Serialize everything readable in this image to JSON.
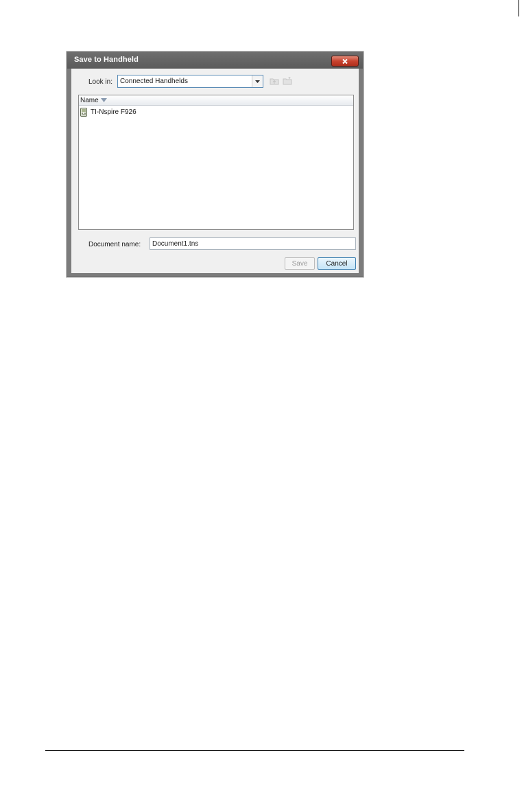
{
  "dialog": {
    "title": "Save to Handheld",
    "close_icon": "close-icon",
    "look_in": {
      "label": "Look in:",
      "value": "Connected Handhelds",
      "dropdown_icon": "chevron-down-icon"
    },
    "toolbar_icons": [
      "folder-up-icon",
      "new-folder-icon"
    ],
    "file_list": {
      "column_header": "Name",
      "sort_icon": "sort-descending-icon",
      "items": [
        {
          "label": "TI-Nspire F926",
          "icon": "handheld-icon"
        }
      ]
    },
    "document_name": {
      "label": "Document name:",
      "value": "Document1.tns"
    },
    "buttons": {
      "save_label": "Save",
      "cancel_label": "Cancel"
    }
  },
  "colors": {
    "close_button": "#c7432f",
    "frame": "#7c7c7c",
    "focus_border": "#3c7fb1"
  }
}
